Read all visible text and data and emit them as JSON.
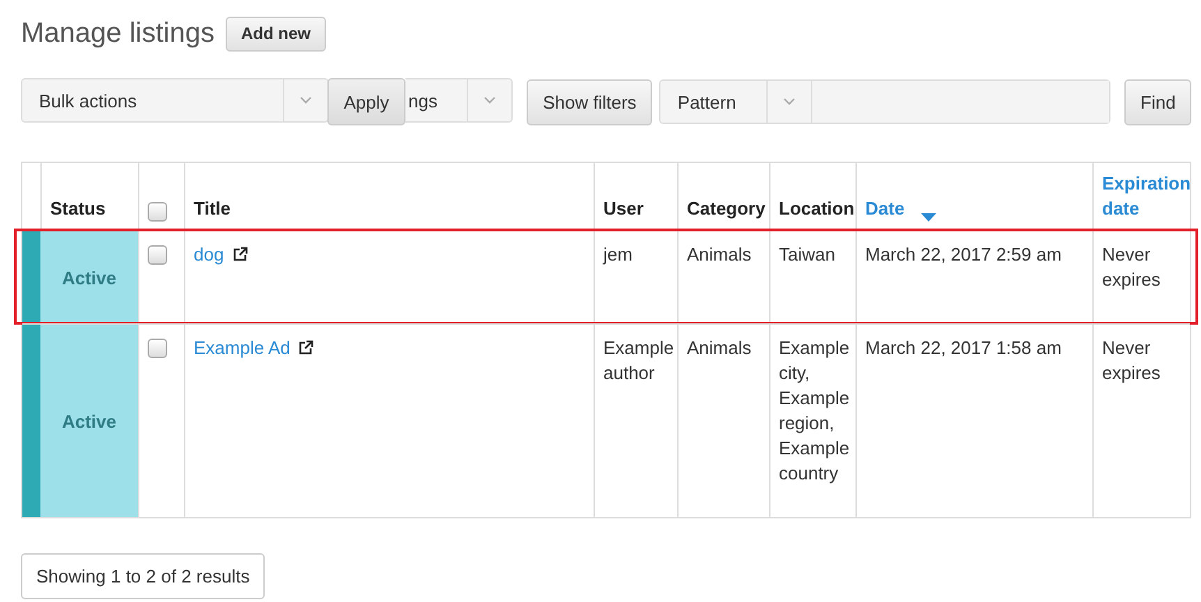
{
  "page_title": "Manage listings",
  "add_button": "Add new",
  "toolbar": {
    "bulk_select": "Bulk actions",
    "apply_button": "Apply",
    "second_select": "ngs",
    "filters_button": "Show filters",
    "search_type": "Pattern",
    "find_button": "Find"
  },
  "table": {
    "header_checkbox": {
      "checked": false
    },
    "columns": [
      {
        "label": "Status",
        "sortable": false,
        "sorted": false
      },
      {
        "label": "Title",
        "sortable": false,
        "sorted": false
      },
      {
        "label": "User",
        "sortable": false,
        "sorted": false
      },
      {
        "label": "Category",
        "sortable": false,
        "sorted": false
      },
      {
        "label": "Location",
        "sortable": false,
        "sorted": false
      },
      {
        "label": "Date",
        "sortable": true,
        "sorted": true
      },
      {
        "label": "Expiration date",
        "sortable": true,
        "sorted": false
      }
    ],
    "rows": [
      {
        "status": "Active",
        "checked": false,
        "highlighted": true,
        "title": "dog",
        "user": "jem",
        "category": "Animals",
        "location": "Taiwan",
        "date": "March 22, 2017 2:59 am",
        "expiration": "Never expires"
      },
      {
        "status": "Active",
        "checked": false,
        "highlighted": false,
        "title": "Example Ad",
        "user": "Example author",
        "category": "Animals",
        "location": "Example city, Example region, Example country",
        "date": "March 22, 2017 1:58 am",
        "expiration": "Never expires"
      }
    ]
  },
  "results_summary": "Showing 1 to 2 of 2 results"
}
